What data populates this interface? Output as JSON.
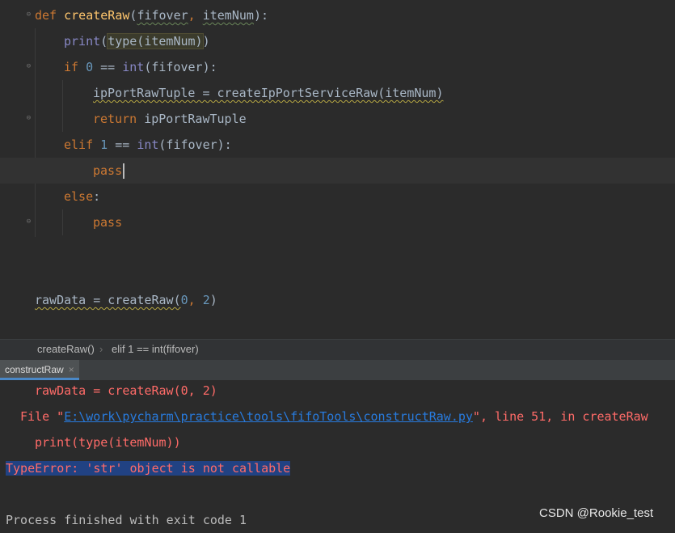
{
  "editor": {
    "lines": {
      "l1": {
        "kw": "def",
        "fn": "createRaw",
        "open": "(",
        "p1": "fifover",
        "sep": ", ",
        "p2": "itemNum",
        "close": "):"
      },
      "l2": {
        "fn": "print",
        "open": "(",
        "inner": "type(itemNum)",
        "close": ")"
      },
      "l3": {
        "kw": "if",
        "num": "0",
        "op": " == ",
        "bi": "int",
        "rest": "(fifover):"
      },
      "l4": {
        "text": "ipPortRawTuple = createIpPortServiceRaw(itemNum)"
      },
      "l5": {
        "kw": "return",
        "rest": " ipPortRawTuple"
      },
      "l6": {
        "kw": "elif",
        "num": "1",
        "op": " == ",
        "bi": "int",
        "rest": "(fifover):"
      },
      "l7": {
        "kw": "pass"
      },
      "l8": {
        "kw": "else",
        "rest": ":"
      },
      "l9": {
        "kw": "pass"
      },
      "l10": {
        "a": "rawData = createRaw(",
        "n1": "0",
        "c": ", ",
        "n2": "2",
        "d": ")"
      }
    }
  },
  "breadcrumbs": {
    "item1": "createRaw()",
    "sep": "›",
    "item2": "elif 1 == int(fifover)"
  },
  "run_panel": {
    "tab_label": "constructRaw",
    "close": "×"
  },
  "console": {
    "l1": "rawData = createRaw(0, 2)",
    "l2_pre": "File \"",
    "l2_link": "E:\\work\\pycharm\\practice\\tools\\fifoTools\\constructRaw.py",
    "l2_post": "\", line 51, in createRaw",
    "l3": "print(type(itemNum))",
    "l4": "TypeError: 'str' object is not callable",
    "l5": "Process finished with exit code 1"
  },
  "watermark": "CSDN @Rookie_test",
  "colors": {
    "background": "#2b2b2b",
    "keyword": "#cc7832",
    "function": "#ffc66d",
    "number": "#6897bb",
    "error": "#ff6b68",
    "link": "#287bde"
  }
}
